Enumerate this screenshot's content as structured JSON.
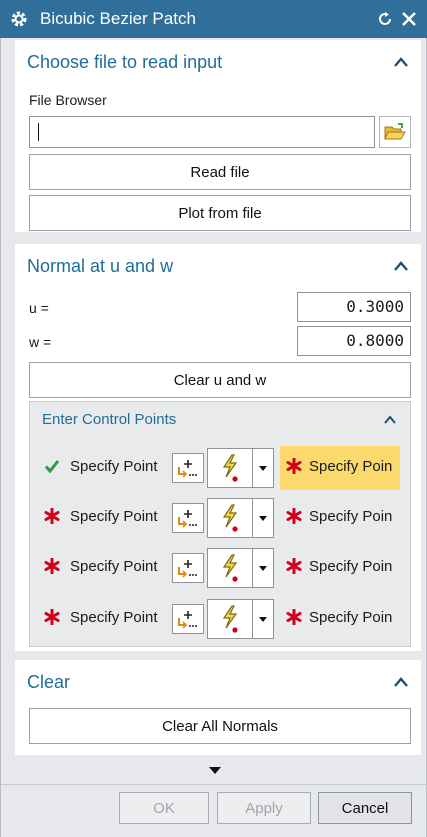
{
  "titlebar": {
    "title": "Bicubic Bezier Patch",
    "icons": [
      "gear-icon",
      "reset-icon",
      "close-icon"
    ]
  },
  "section_input": {
    "header": "Choose file to read input",
    "file_browser_label": "File Browser",
    "file_path_value": "",
    "read_file_label": "Read file",
    "plot_label": "Plot from file"
  },
  "section_normal": {
    "header": "Normal at u and w",
    "u_label": "u =",
    "u_value": "0.3000",
    "w_label": "w =",
    "w_value": "0.8000",
    "clear_uw_label": "Clear u and w",
    "control_points": {
      "header": "Enter Control Points",
      "rows": [
        {
          "left_label": "Specify Point",
          "left_status": "done",
          "right_label": "Specify Poin",
          "right_status": "required",
          "right_active": true
        },
        {
          "left_label": "Specify Point",
          "left_status": "required",
          "right_label": "Specify Poin",
          "right_status": "required",
          "right_active": false
        },
        {
          "left_label": "Specify Point",
          "left_status": "required",
          "right_label": "Specify Poin",
          "right_status": "required",
          "right_active": false
        },
        {
          "left_label": "Specify Point",
          "left_status": "required",
          "right_label": "Specify Poin",
          "right_status": "required",
          "right_active": false
        }
      ]
    }
  },
  "section_clear": {
    "header": "Clear",
    "clear_all_label": "Clear All Normals"
  },
  "footer": {
    "ok_label": "OK",
    "apply_label": "Apply",
    "cancel_label": "Cancel"
  },
  "colors": {
    "titlebar": "#2f6f99",
    "section_header_text": "#1f6e98",
    "required_star": "#d0021b",
    "done_check": "#2e9b3a",
    "active_highlight": "#fbd96d"
  }
}
